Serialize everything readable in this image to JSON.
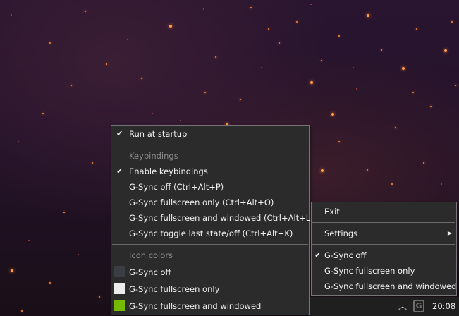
{
  "context_menu": {
    "run_at_startup": "Run at startup",
    "keybindings_header": "Keybindings",
    "enable_keybindings": "Enable keybindings",
    "gsync_off_key": "G-Sync off (Ctrl+Alt+P)",
    "gsync_fullscreen_key": "G-Sync fullscreen only (Ctrl+Alt+O)",
    "gsync_fullscreen_windowed_key": "G-Sync fullscreen and windowed (Ctrl+Alt+L)",
    "gsync_toggle_key": "G-Sync toggle last state/off (Ctrl+Alt+K)",
    "icon_colors_header": "Icon colors",
    "color_off": "G-Sync off",
    "color_fullscreen": "G-Sync fullscreen only",
    "color_fullscreen_windowed": "G-Sync fullscreen and windowed",
    "swatch_colors": {
      "off": "#3a3d42",
      "fullscreen": "#ececec",
      "fullscreen_windowed": "#76b900"
    },
    "checked": [
      "run_at_startup",
      "enable_keybindings"
    ]
  },
  "tray_menu": {
    "exit": "Exit",
    "settings": "Settings",
    "gsync_off": "G-Sync off",
    "gsync_fullscreen_only": "G-Sync fullscreen only",
    "gsync_fullscreen_windowed": "G-Sync fullscreen and windowed",
    "checked": [
      "gsync_off"
    ]
  },
  "taskbar": {
    "tray_icon_letter": "G",
    "clock": "20:08",
    "icons": [
      "chevron-up-icon",
      "gsync-tray-icon"
    ]
  }
}
